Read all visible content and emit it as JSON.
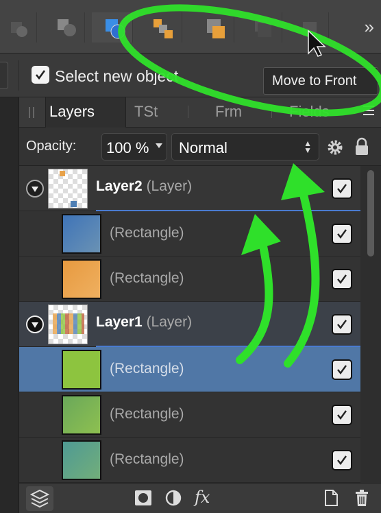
{
  "toolbar": {
    "more_glyph": "»",
    "buttons": [
      {
        "name": "move-to-back-button"
      },
      {
        "name": "move-back-one-button"
      },
      {
        "name": "move-forward-one-button"
      },
      {
        "name": "move-to-front-button"
      }
    ]
  },
  "context": {
    "select_new_object_checked": true,
    "select_new_object_label": "Select new object"
  },
  "tooltip": {
    "text": "Move to Front"
  },
  "tabs": [
    {
      "label": "Layers",
      "active": true
    },
    {
      "label": "TSt",
      "active": false
    },
    {
      "label": "Frm",
      "active": false
    },
    {
      "label": "Fields",
      "active": false
    }
  ],
  "opacity": {
    "label": "Opacity:",
    "value": "100 %",
    "blend_mode": "Normal"
  },
  "layers": [
    {
      "name": "Layer2",
      "type": "(Layer)",
      "visible": true,
      "expanded": true,
      "children": [
        {
          "name": "(Rectangle)",
          "color": "#4f7fb4",
          "visible": true
        },
        {
          "name": "(Rectangle)",
          "color": "#e8a24a",
          "visible": true
        }
      ]
    },
    {
      "name": "Layer1",
      "type": "(Layer)",
      "visible": true,
      "expanded": true,
      "children": [
        {
          "name": "(Rectangle)",
          "color": "#8dc43f",
          "visible": true,
          "selected": true
        },
        {
          "name": "(Rectangle)",
          "color": "#74b45a",
          "visible": true
        },
        {
          "name": "(Rectangle)",
          "color": "#5ea08a",
          "visible": true
        }
      ]
    }
  ],
  "colors": {
    "selection": "#5077a6",
    "annotation": "#2fe02a",
    "accent_line": "#4a7bd0"
  }
}
